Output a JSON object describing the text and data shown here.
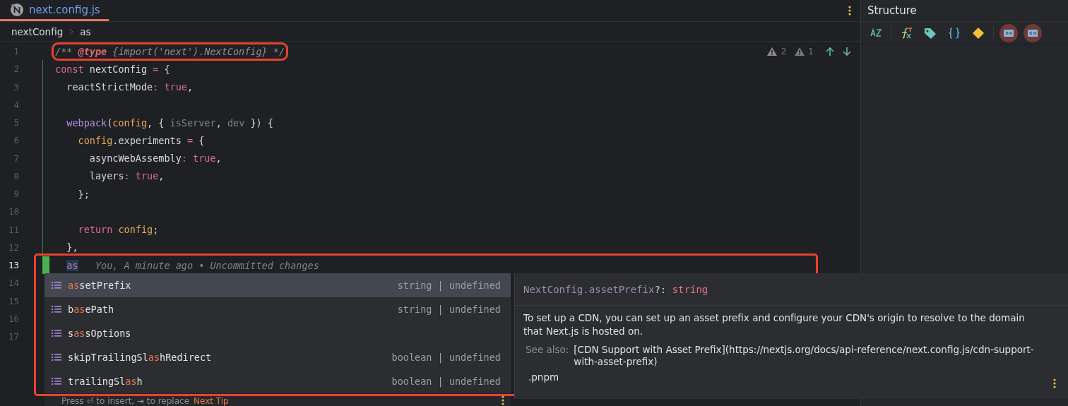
{
  "tabs": [
    {
      "label": "next.config.js",
      "selected": true
    }
  ],
  "breadcrumbs": [
    "nextConfig",
    "as"
  ],
  "inspections": [
    {
      "kind": "warning",
      "count": "2"
    },
    {
      "kind": "weak-warning",
      "count": "1"
    }
  ],
  "lines": [
    {
      "number": "1",
      "current": false,
      "changed": false,
      "outlined": true,
      "tokens": [
        {
          "kind": "comment",
          "text": "/** "
        },
        {
          "kind": "doctag",
          "text": "@type"
        },
        {
          "kind": "comment",
          "text": " {import('next').NextConfig} */"
        }
      ]
    },
    {
      "number": "2",
      "current": false,
      "changed": true,
      "outlined": false,
      "tokens": [
        {
          "kind": "keyword",
          "text": "const "
        },
        {
          "kind": "plain",
          "text": "nextConfig "
        },
        {
          "kind": "keyword",
          "text": "= "
        },
        {
          "kind": "plain",
          "text": "{"
        }
      ]
    },
    {
      "number": "3",
      "current": false,
      "changed": true,
      "outlined": false,
      "tokens": [
        {
          "kind": "plain",
          "text": "  reactStrictMode"
        },
        {
          "kind": "keyword",
          "text": ": true"
        },
        {
          "kind": "plain",
          "text": ","
        }
      ]
    },
    {
      "number": "4",
      "current": false,
      "changed": true,
      "outlined": false
    },
    {
      "number": "5",
      "current": false,
      "changed": true,
      "outlined": false,
      "tokens": [
        {
          "kind": "function",
          "text": "  webpack"
        },
        {
          "kind": "plain",
          "text": "("
        },
        {
          "kind": "param",
          "text": "config"
        },
        {
          "kind": "plain",
          "text": ", { "
        },
        {
          "kind": "unused",
          "text": "isServer"
        },
        {
          "kind": "plain",
          "text": ", "
        },
        {
          "kind": "unused",
          "text": "dev"
        },
        {
          "kind": "plain",
          "text": " }) {"
        }
      ]
    },
    {
      "number": "6",
      "current": false,
      "changed": true,
      "outlined": false,
      "tokens": [
        {
          "kind": "param",
          "text": "    config"
        },
        {
          "kind": "plain",
          "text": ".experiments "
        },
        {
          "kind": "keyword",
          "text": "= "
        },
        {
          "kind": "plain",
          "text": "{"
        }
      ]
    },
    {
      "number": "7",
      "current": false,
      "changed": true,
      "outlined": false,
      "tokens": [
        {
          "kind": "plain",
          "text": "      asyncWebAssembly"
        },
        {
          "kind": "keyword",
          "text": ": true"
        },
        {
          "kind": "plain",
          "text": ","
        }
      ]
    },
    {
      "number": "8",
      "current": false,
      "changed": true,
      "outlined": false,
      "tokens": [
        {
          "kind": "plain",
          "text": "      layers"
        },
        {
          "kind": "keyword",
          "text": ": true"
        },
        {
          "kind": "plain",
          "text": ","
        }
      ]
    },
    {
      "number": "9",
      "current": false,
      "changed": true,
      "outlined": false,
      "tokens": [
        {
          "kind": "plain",
          "text": "    };"
        }
      ]
    },
    {
      "number": "10",
      "current": false,
      "changed": true,
      "outlined": false
    },
    {
      "number": "11",
      "current": false,
      "changed": true,
      "outlined": false,
      "tokens": [
        {
          "kind": "keyword",
          "text": "    return "
        },
        {
          "kind": "param",
          "text": "config"
        },
        {
          "kind": "plain",
          "text": ";"
        }
      ]
    },
    {
      "number": "12",
      "current": false,
      "changed": true,
      "outlined": false,
      "tokens": [
        {
          "kind": "plain",
          "text": "  },"
        }
      ]
    },
    {
      "number": "13",
      "current": true,
      "changed": true,
      "outlined": false,
      "tokens": [
        {
          "kind": "typed",
          "text": "as"
        },
        {
          "kind": "blame",
          "text": "You, A minute ago • Uncommitted changes"
        }
      ]
    },
    {
      "number": "14",
      "current": false,
      "changed": false,
      "outlined": false
    },
    {
      "number": "15",
      "current": false,
      "changed": false,
      "outlined": false
    },
    {
      "number": "16",
      "current": false,
      "changed": false,
      "outlined": false
    },
    {
      "number": "17",
      "current": false,
      "changed": false,
      "outlined": false
    }
  ],
  "completion": {
    "outlined": true,
    "items": [
      {
        "selected": true,
        "name": [
          {
            "text": "as",
            "match": true
          },
          {
            "text": "setPrefix",
            "match": false
          }
        ],
        "type": "string | undefined"
      },
      {
        "selected": false,
        "name": [
          {
            "text": "b",
            "match": false
          },
          {
            "text": "as",
            "match": true
          },
          {
            "text": "ePath",
            "match": false
          }
        ],
        "type": "string | undefined"
      },
      {
        "selected": false,
        "name": [
          {
            "text": "s",
            "match": false
          },
          {
            "text": "as",
            "match": true
          },
          {
            "text": "sOptions",
            "match": false
          }
        ]
      },
      {
        "selected": false,
        "name": [
          {
            "text": "skipTrailingSl",
            "match": false
          },
          {
            "text": "as",
            "match": true
          },
          {
            "text": "hRedirect",
            "match": false
          }
        ],
        "type": "boolean | undefined"
      },
      {
        "selected": false,
        "name": [
          {
            "text": "trailingSl",
            "match": false
          },
          {
            "text": "as",
            "match": true
          },
          {
            "text": "h",
            "match": false
          }
        ],
        "type": "boolean | undefined"
      }
    ],
    "hint": "Press ⏎ to insert, ⇥ to replace",
    "tip_link": "Next Tip"
  },
  "documentation": {
    "qualifier": "NextConfig.assetPrefix",
    "separator": "?:",
    "type": "string",
    "description": "To set up a CDN, you can set up an asset prefix and configure your CDN's origin to resolve to the domain that Next.js is hosted on.",
    "see_also_label": "See also:",
    "see_also": "[CDN Support with Asset Prefix](https://nextjs.org/docs/api-reference/next.config.js/cdn-support-with-asset-prefix)",
    "location": ".pnpm"
  },
  "structure": {
    "title": "Structure",
    "tools": [
      {
        "kind": "sort",
        "highlighted": false
      },
      {
        "kind": "function",
        "highlighted": false
      },
      {
        "kind": "tag",
        "highlighted": false
      },
      {
        "kind": "braces",
        "highlighted": false
      },
      {
        "kind": "diamond",
        "highlighted": false
      },
      {
        "kind": "expand",
        "highlighted": true
      },
      {
        "kind": "collapse",
        "highlighted": true
      }
    ]
  }
}
